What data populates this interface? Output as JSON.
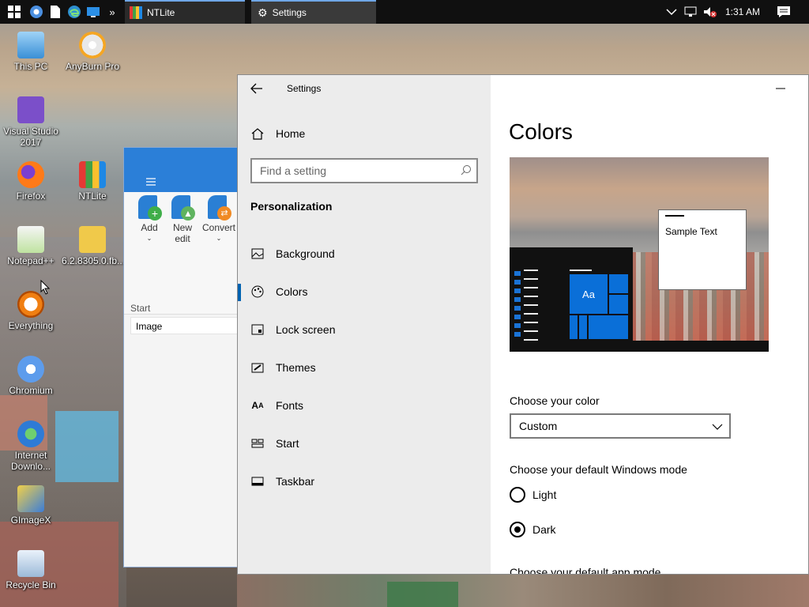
{
  "taskbar": {
    "tasks": [
      {
        "label": "NTLite"
      },
      {
        "label": "Settings"
      }
    ],
    "overflow_glyph": "»",
    "clock": "1:31 AM"
  },
  "desktop_icons": [
    {
      "label": "This PC"
    },
    {
      "label": "AnyBurn Pro"
    },
    {
      "label": "Visual Studio 2017"
    },
    {
      "label": "Firefox"
    },
    {
      "label": "NTLite"
    },
    {
      "label": "Notepad++"
    },
    {
      "label": "6.2.8305.0.fb..."
    },
    {
      "label": "Everything"
    },
    {
      "label": "Chromium"
    },
    {
      "label": "Internet Downlo..."
    },
    {
      "label": "GImageX"
    },
    {
      "label": "Recycle Bin"
    }
  ],
  "ntlite": {
    "buttons": [
      {
        "label": "Add"
      },
      {
        "label": "New edit"
      },
      {
        "label": "Convert"
      }
    ],
    "section_label": "Start",
    "list_item": "Image"
  },
  "settings": {
    "window_title": "Settings",
    "home_label": "Home",
    "search_placeholder": "Find a setting",
    "section_title": "Personalization",
    "nav_items": [
      {
        "label": "Background",
        "icon": "image-icon"
      },
      {
        "label": "Colors",
        "icon": "palette-icon"
      },
      {
        "label": "Lock screen",
        "icon": "lock-screen-icon"
      },
      {
        "label": "Themes",
        "icon": "themes-icon"
      },
      {
        "label": "Fonts",
        "icon": "fonts-icon"
      },
      {
        "label": "Start",
        "icon": "start-icon"
      },
      {
        "label": "Taskbar",
        "icon": "taskbar-icon"
      }
    ],
    "page_title": "Colors",
    "preview": {
      "sample_text": "Sample Text",
      "tile_text": "Aa",
      "accent_color": "#0a6fd8"
    },
    "choose_color_label": "Choose your color",
    "choose_color_value": "Custom",
    "windows_mode_label": "Choose your default Windows mode",
    "modes": [
      {
        "label": "Light",
        "checked": false
      },
      {
        "label": "Dark",
        "checked": true
      }
    ],
    "app_mode_label": "Choose your default app mode"
  }
}
